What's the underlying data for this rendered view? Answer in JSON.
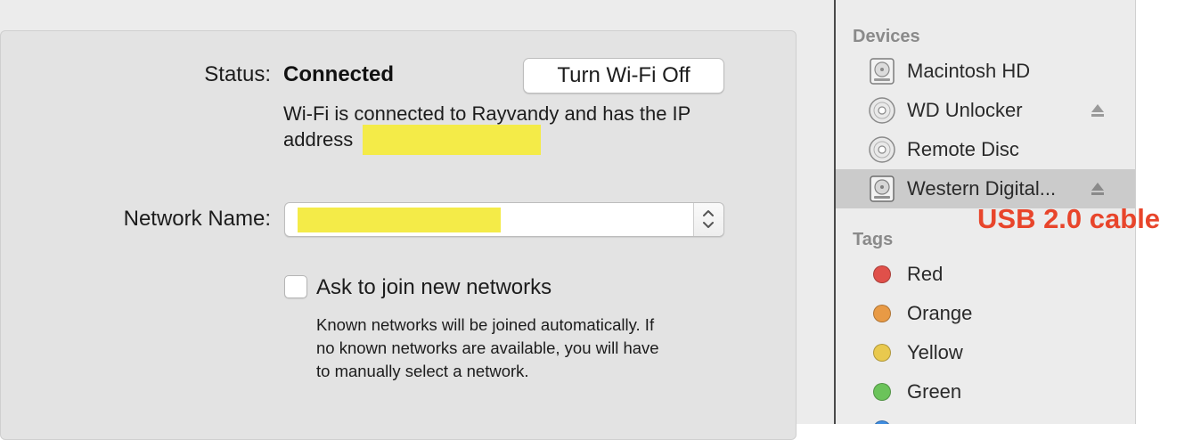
{
  "network_prefs": {
    "status_label": "Status:",
    "status_value": "Connected",
    "wifi_toggle_button": "Turn Wi-Fi Off",
    "status_description_line1": "Wi-Fi is connected to Rayvandy and has the IP",
    "status_description_line2": "address",
    "network_name_label": "Network Name:",
    "network_name_value": "",
    "ask_to_join_label": "Ask to join new networks",
    "ask_to_join_checked": false,
    "ask_to_join_help": [
      "Known networks will be joined automatically. If",
      "no known networks are available, you will have",
      "to manually select a network."
    ],
    "redaction_color": "#f4eb48"
  },
  "sidebar": {
    "devices_title": "Devices",
    "devices": [
      {
        "label": "Macintosh HD",
        "icon": "hard-drive-icon",
        "eject": false,
        "selected": false
      },
      {
        "label": "WD Unlocker",
        "icon": "optical-disc-icon",
        "eject": true,
        "selected": false
      },
      {
        "label": "Remote Disc",
        "icon": "optical-disc-icon",
        "eject": false,
        "selected": false
      },
      {
        "label": "Western Digital...",
        "icon": "hard-drive-icon",
        "eject": true,
        "selected": true
      }
    ],
    "tags_title": "Tags",
    "tags": [
      {
        "label": "Red",
        "color": "#e0504a"
      },
      {
        "label": "Orange",
        "color": "#e89a45"
      },
      {
        "label": "Yellow",
        "color": "#e9c94e"
      },
      {
        "label": "Green",
        "color": "#6bc35a"
      }
    ],
    "partial_tag_color": "#3f8de0"
  },
  "annotation": {
    "text": "USB 2.0 cable",
    "color": "#e8452b"
  }
}
